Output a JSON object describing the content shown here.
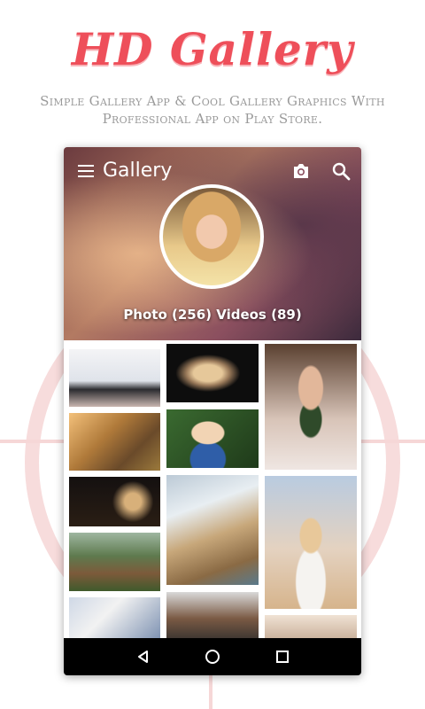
{
  "promo": {
    "headline": "HD Gallery",
    "subline": "Simple Gallery App & Cool Gallery Graphics With Professional App on Play Store."
  },
  "appbar": {
    "title": "Gallery",
    "icons": [
      "menu-icon",
      "camera-icon",
      "search-icon"
    ]
  },
  "profile": {
    "stats": "Photo (256) Videos (89)"
  },
  "gallery": {
    "items": [
      "baby-with-pigtails-photo",
      "child-hiding-face-photo",
      "woman-with-leaf-photo",
      "couple-in-field-photo",
      "toddler-portrait-photo",
      "night-lights-couple-photo",
      "man-on-pier-photo",
      "girl-on-beach-photo",
      "child-in-grass-photo",
      "family-outdoors-photo",
      "father-and-child-photo",
      "child-partial-photo"
    ]
  },
  "navbar": {
    "icons": [
      "back-icon",
      "home-icon",
      "recent-apps-icon"
    ]
  },
  "colors": {
    "accent": "#ee4f5a",
    "subtext": "#9a9a9a",
    "navbar": "#000000"
  }
}
